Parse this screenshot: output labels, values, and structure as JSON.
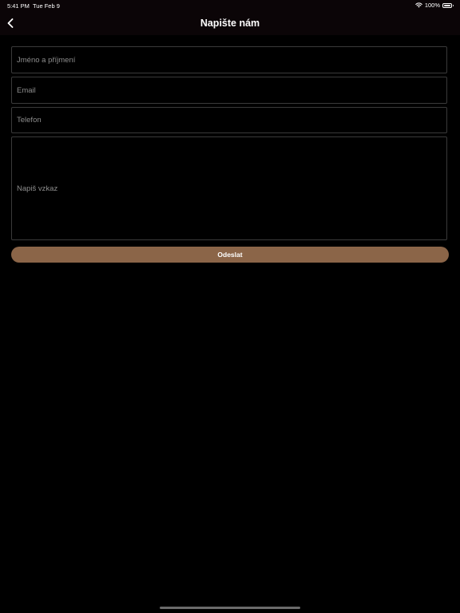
{
  "status_bar": {
    "time": "5:41 PM",
    "date": "Tue Feb 9",
    "battery": "100%",
    "wifi_icon": "wifi-icon",
    "battery_icon": "battery-icon"
  },
  "nav": {
    "title": "Napište nám",
    "back_icon": "chevron-left-icon"
  },
  "form": {
    "name_placeholder": "Jméno a příjmení",
    "email_placeholder": "Email",
    "phone_placeholder": "Telefon",
    "message_placeholder": "Napiš vzkaz",
    "submit_label": "Odeslat"
  },
  "colors": {
    "background": "#000000",
    "bar": "#0b0507",
    "accent": "#8b6548",
    "field_border": "#3a3a3a",
    "placeholder": "#8d8d8d"
  }
}
